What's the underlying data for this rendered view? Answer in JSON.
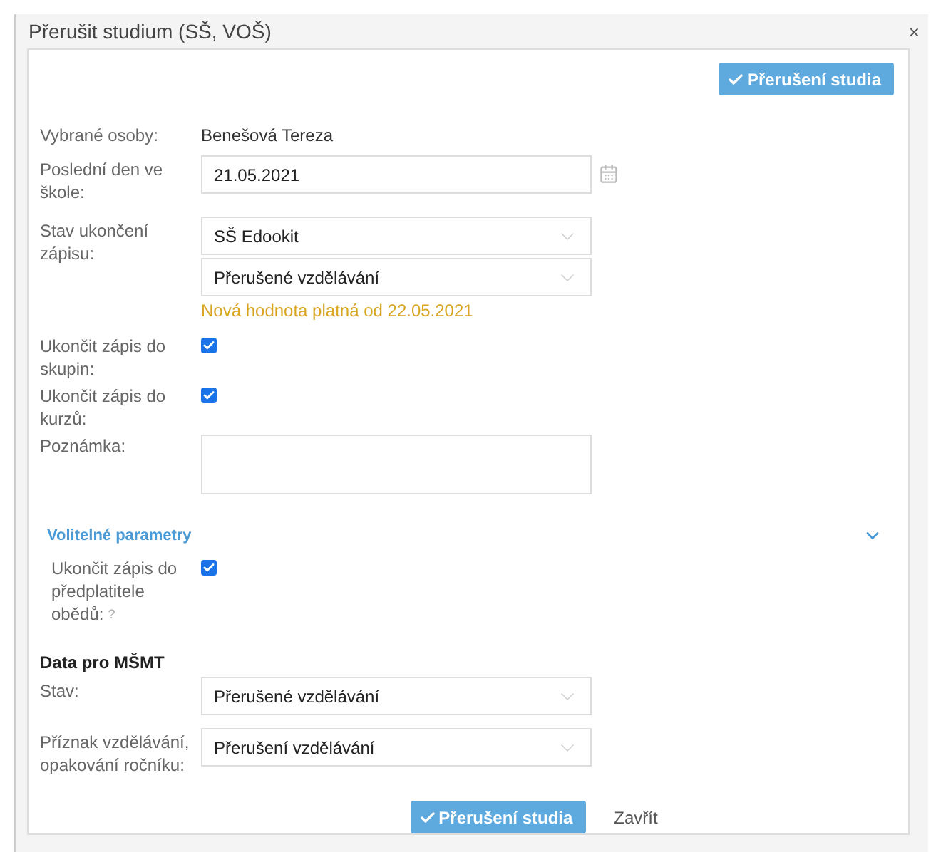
{
  "dialog": {
    "title": "Přerušit studium (SŠ, VOŠ)",
    "close": "×"
  },
  "top_button": {
    "label": "Přerušení studia"
  },
  "rows": [
    {
      "kind": "text",
      "label": "Vybrané osoby:",
      "value": "Benešová Tereza"
    },
    {
      "kind": "date",
      "label": "Poslední den ve škole:",
      "value": "21.05.2021"
    },
    {
      "kind": "selects",
      "label": "Stav ukončení zápisu:",
      "values": [
        "SŠ Edookit",
        "Přerušené vzdělávání"
      ],
      "note": "Nová hodnota platná od 22.05.2021"
    },
    {
      "kind": "checkbox",
      "label": "Ukončit zápis do skupin:",
      "checked": true
    },
    {
      "kind": "checkbox",
      "label": "Ukončit zápis do kurzů:",
      "checked": true
    },
    {
      "kind": "textarea",
      "label": "Poznámka:"
    }
  ],
  "optional": {
    "title": "Volitelné parametry",
    "expanded": true,
    "rows": [
      {
        "kind": "checkbox",
        "label": "Ukončit zápis do předplatitele obědů:",
        "help": "?",
        "checked": true
      }
    ]
  },
  "msmt": {
    "title": "Data pro MŠMT",
    "rows": [
      {
        "kind": "selects",
        "label": "Stav:",
        "values": [
          "Přerušené vzdělávání"
        ]
      },
      {
        "kind": "selects",
        "label": "Příznak vzdělávání, opakování ročníku:",
        "values": [
          "Přerušení vzdělávání"
        ]
      }
    ]
  },
  "footer": {
    "submit": "Přerušení studia",
    "close": "Zavřít"
  }
}
